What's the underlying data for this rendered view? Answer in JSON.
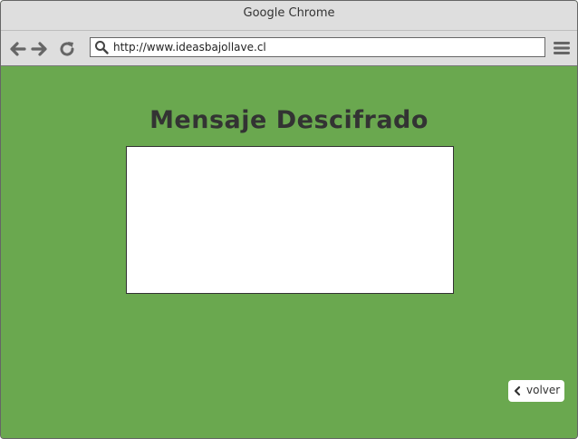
{
  "window": {
    "title": "Google Chrome"
  },
  "toolbar": {
    "url": "http://www.ideasbajollave.cl",
    "icons": [
      "back-arrow-icon",
      "forward-arrow-icon",
      "reload-icon",
      "search-icon",
      "menu-icon"
    ]
  },
  "page": {
    "heading": "Mensaje Descifrado",
    "message": "",
    "back_label": "volver",
    "background_color": "#6aa84f"
  }
}
